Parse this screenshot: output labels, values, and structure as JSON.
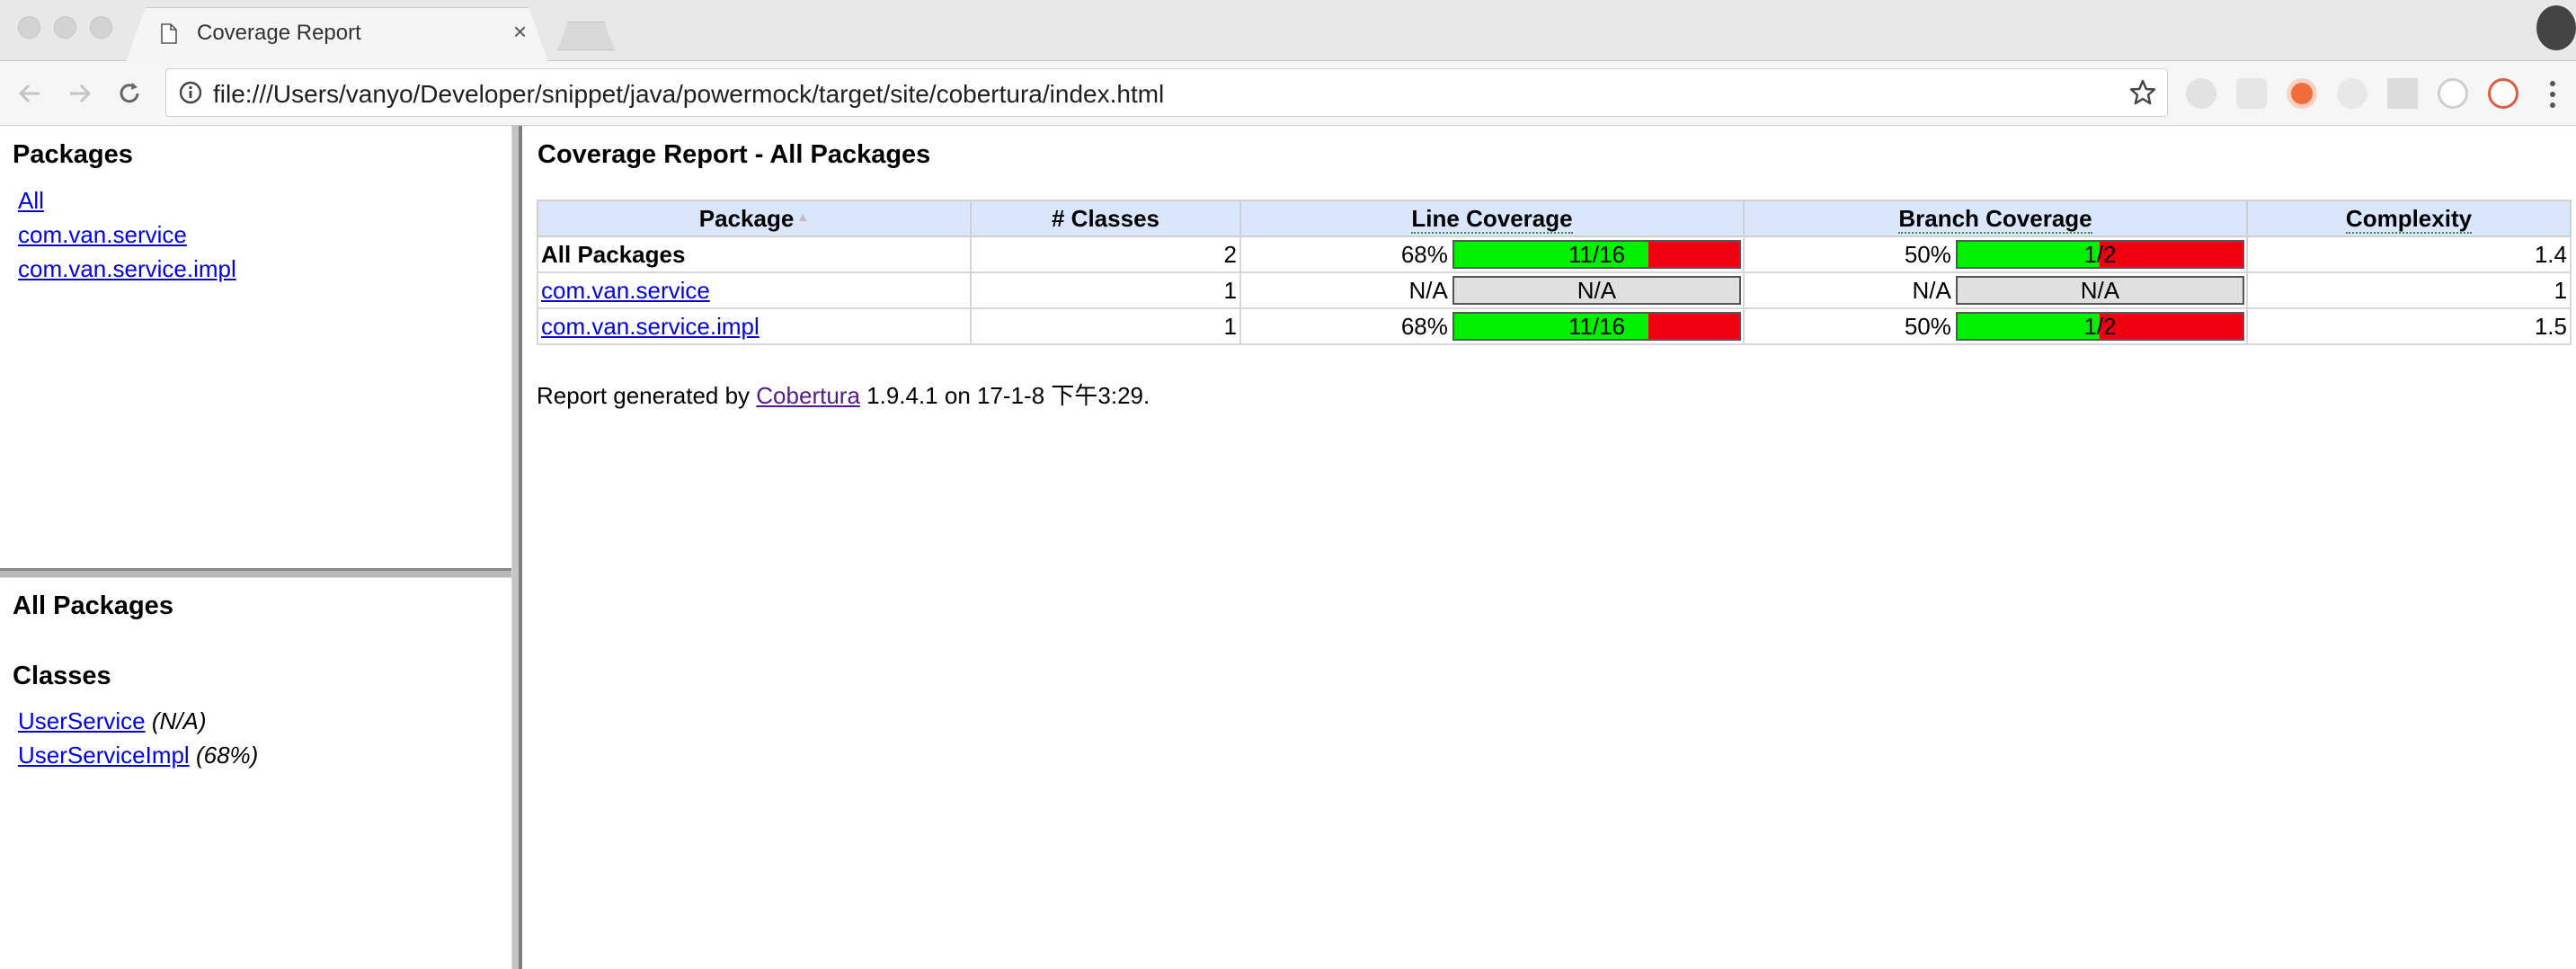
{
  "browser": {
    "tab_title": "Coverage Report",
    "tab_close": "×",
    "url": "file:///Users/vanyo/Developer/snippet/java/powermock/target/site/cobertura/index.html"
  },
  "packages_frame": {
    "heading": "Packages",
    "items": [
      "All",
      "com.van.service",
      "com.van.service.impl"
    ]
  },
  "classes_frame": {
    "heading": "All Packages",
    "subheading": "Classes",
    "items": [
      {
        "name": "UserService",
        "coverage": "(N/A)"
      },
      {
        "name": "UserServiceImpl",
        "coverage": "(68%)"
      }
    ]
  },
  "main": {
    "title": "Coverage Report - All Packages",
    "columns": [
      "Package",
      "# Classes",
      "Line Coverage",
      "Branch Coverage",
      "Complexity"
    ],
    "sort_indicator": "▲",
    "rows": [
      {
        "name": "All Packages",
        "is_link": false,
        "classes": "2",
        "line_pct": "68%",
        "line_label": "11/16",
        "line_fraction": 0.68,
        "branch_pct": "50%",
        "branch_label": "1/2",
        "branch_fraction": 0.5,
        "complexity": "1.4"
      },
      {
        "name": "com.van.service",
        "is_link": true,
        "classes": "1",
        "line_pct": "N/A",
        "line_label": "N/A",
        "line_fraction": null,
        "branch_pct": "N/A",
        "branch_label": "N/A",
        "branch_fraction": null,
        "complexity": "1"
      },
      {
        "name": "com.van.service.impl",
        "is_link": true,
        "classes": "1",
        "line_pct": "68%",
        "line_label": "11/16",
        "line_fraction": 0.68,
        "branch_pct": "50%",
        "branch_label": "1/2",
        "branch_fraction": 0.5,
        "complexity": "1.5"
      }
    ],
    "footer": {
      "prefix": "Report generated by ",
      "link": "Cobertura",
      "suffix": " 1.9.4.1 on 17-1-8 下午3:29."
    }
  },
  "colors": {
    "covered": "#00f000",
    "uncovered": "#ee0011",
    "na": "#e0e0e0",
    "header_bg": "#d9e6fb",
    "link": "#0000ee"
  }
}
